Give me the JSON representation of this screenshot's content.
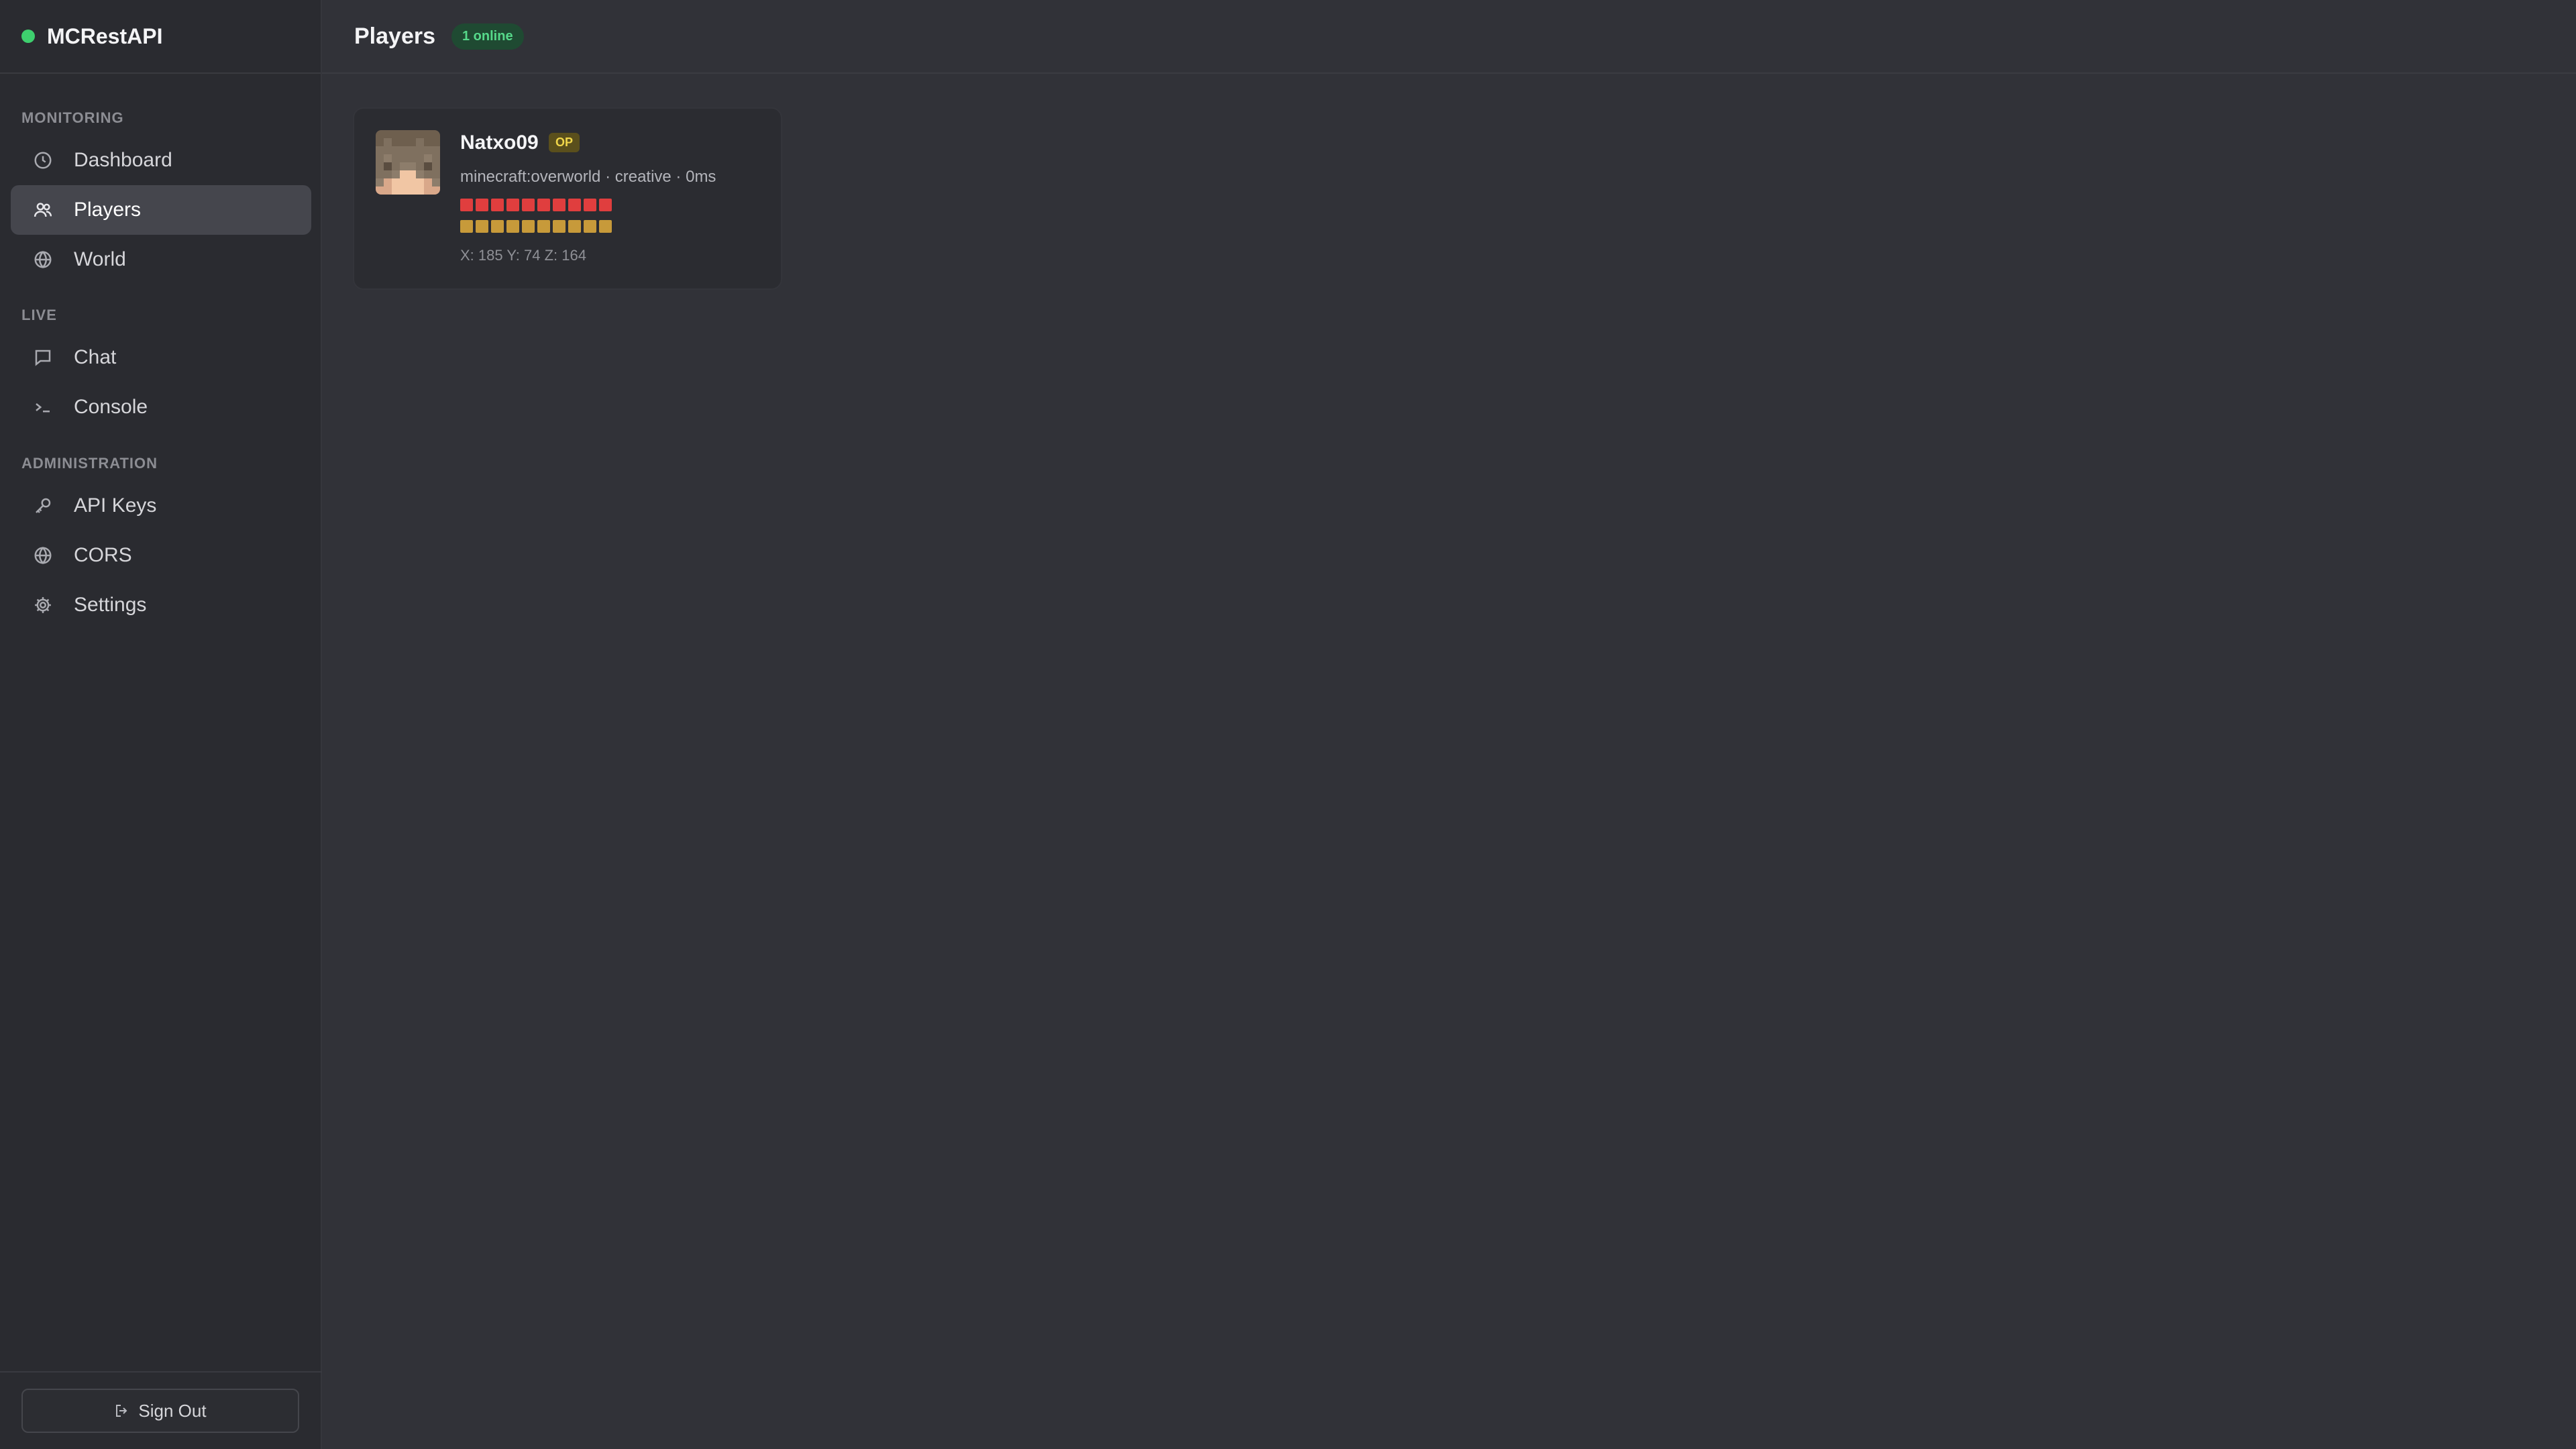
{
  "app": {
    "name": "MCRestAPI",
    "status_color": "#3ecf6e"
  },
  "sidebar": {
    "sections": [
      {
        "label": "MONITORING",
        "items": [
          {
            "label": "Dashboard",
            "icon": "clock-icon",
            "active": false
          },
          {
            "label": "Players",
            "icon": "users-icon",
            "active": true
          },
          {
            "label": "World",
            "icon": "globe-icon",
            "active": false
          }
        ]
      },
      {
        "label": "LIVE",
        "items": [
          {
            "label": "Chat",
            "icon": "chat-icon",
            "active": false
          },
          {
            "label": "Console",
            "icon": "terminal-icon",
            "active": false
          }
        ]
      },
      {
        "label": "ADMINISTRATION",
        "items": [
          {
            "label": "API Keys",
            "icon": "key-icon",
            "active": false
          },
          {
            "label": "CORS",
            "icon": "globe-icon",
            "active": false
          },
          {
            "label": "Settings",
            "icon": "gear-icon",
            "active": false
          }
        ]
      }
    ],
    "sign_out_label": "Sign Out"
  },
  "header": {
    "title": "Players",
    "online_badge": "1 online"
  },
  "players": [
    {
      "name": "Natxo09",
      "badge": "OP",
      "meta": "minecraft:overworld · creative · 0ms",
      "health_pips": 10,
      "health_color": "#e03e3e",
      "food_pips": 10,
      "food_color": "#c79a3a",
      "coords": "X: 185 Y: 74 Z: 164"
    }
  ]
}
